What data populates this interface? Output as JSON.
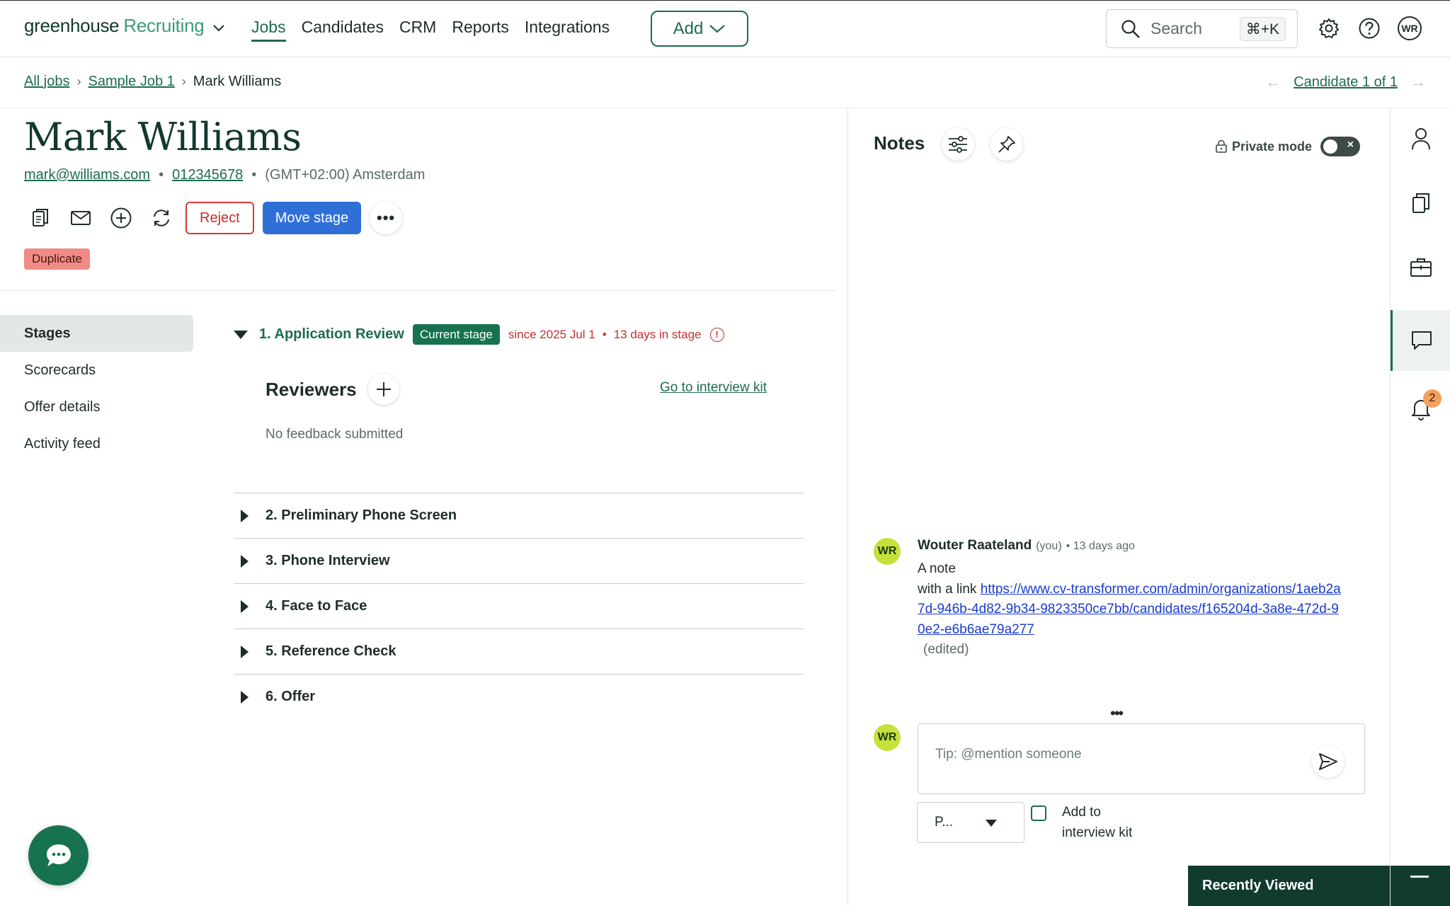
{
  "brand": {
    "name": "greenhouse",
    "product": "Recruiting"
  },
  "nav": {
    "links": [
      {
        "label": "Jobs",
        "active": true
      },
      {
        "label": "Candidates"
      },
      {
        "label": "CRM"
      },
      {
        "label": "Reports"
      },
      {
        "label": "Integrations"
      }
    ],
    "add_label": "Add",
    "search_label": "Search",
    "search_shortcut": "⌘+K",
    "user_initials": "WR"
  },
  "breadcrumb": {
    "all_jobs": "All jobs",
    "job": "Sample Job 1",
    "current": "Mark Williams",
    "candidate_position": "Candidate 1 of 1"
  },
  "candidate": {
    "name": "Mark Williams",
    "email": "mark@williams.com",
    "phone": "012345678",
    "timezone": "(GMT+02:00) Amsterdam",
    "reject_label": "Reject",
    "move_stage_label": "Move stage",
    "more_label": "•••",
    "duplicate_badge": "Duplicate"
  },
  "subnav": {
    "items": [
      "Stages",
      "Scorecards",
      "Offer details",
      "Activity feed"
    ],
    "active_index": 0
  },
  "current_stage": {
    "title": "1. Application Review",
    "badge": "Current stage",
    "since": "since 2025 Jul 1",
    "days": "13 days in stage",
    "reviewers_title": "Reviewers",
    "interview_kit_link": "Go to interview kit",
    "no_feedback": "No feedback submitted"
  },
  "stages": [
    "2. Preliminary Phone Screen",
    "3. Phone Interview",
    "4. Face to Face",
    "5. Reference Check",
    "6. Offer"
  ],
  "notes": {
    "title": "Notes",
    "private_mode_label": "Private mode",
    "private_mode_on": false,
    "note": {
      "author_initials": "WR",
      "author": "Wouter Raateland",
      "you": "(you)",
      "time": "• 13 days ago",
      "line1": "A note",
      "line2_prefix": "with a link",
      "link": "https://www.cv-transformer.com/admin/organizations/1aeb2a7d-946b-4d82-9b34-9823350ce7bb/candidates/f165204d-3a8e-472d-90e2-e6b6ae79a277",
      "edited": "(edited)"
    },
    "compose": {
      "author_initials": "WR",
      "placeholder": "Tip: @mention someone",
      "visibility_value": "P...",
      "add_to_kit_label": "Add to interview kit",
      "add_to_kit_checked": false
    },
    "recently_viewed": "Recently Viewed"
  },
  "rail": {
    "notification_count": "2"
  },
  "colors": {
    "brand_green": "#1d6b50",
    "primary_blue": "#2f6fd8",
    "danger_red": "#c62f2f",
    "avatar_lime": "#c4e23a"
  }
}
